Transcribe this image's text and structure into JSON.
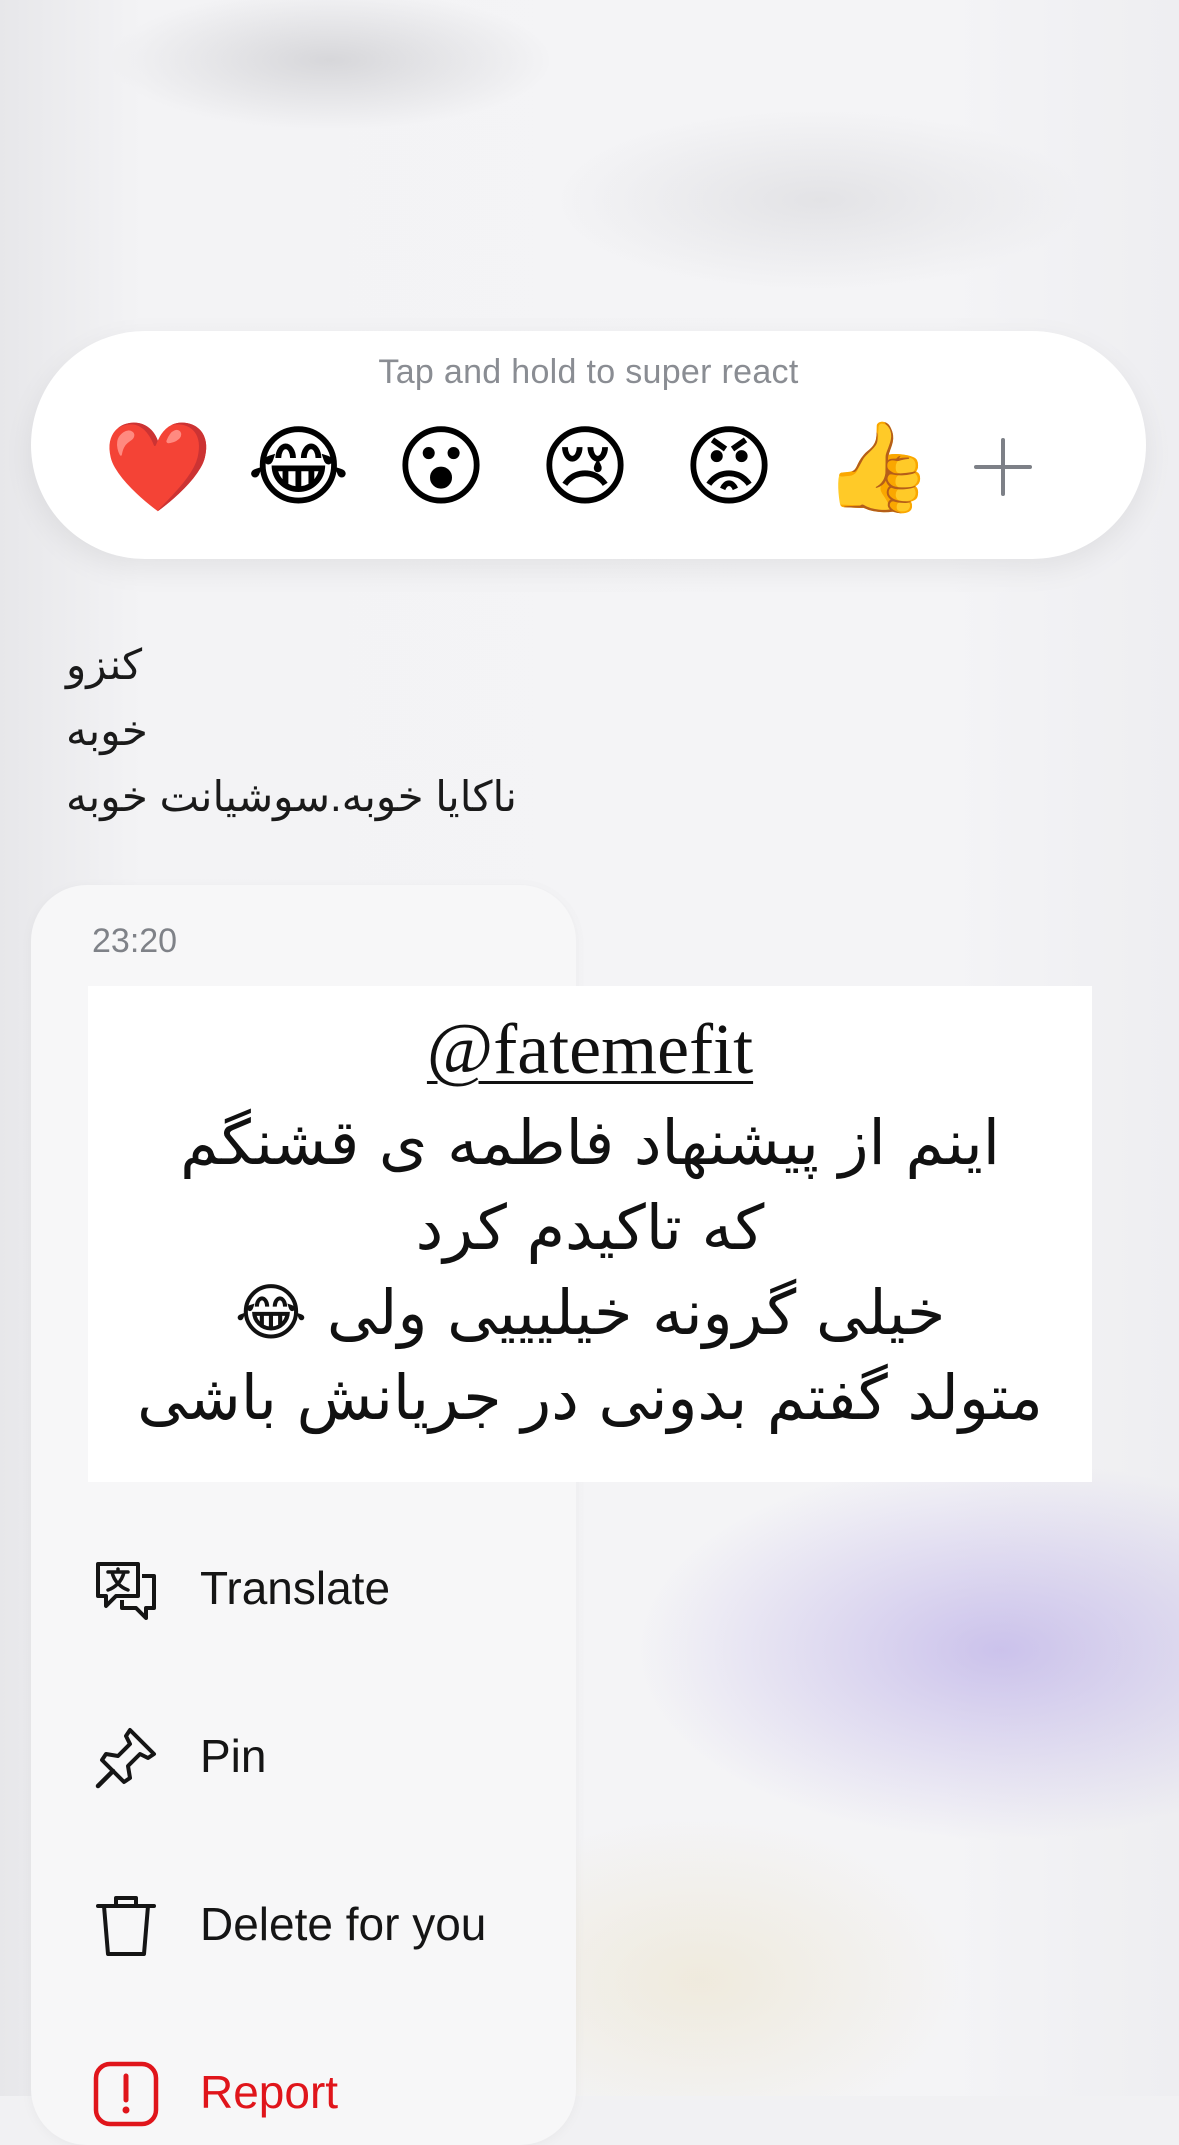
{
  "reaction_bar": {
    "hint": "Tap and hold to super react",
    "emojis": [
      {
        "name": "heart",
        "glyph": "❤️"
      },
      {
        "name": "laugh",
        "glyph": "😂"
      },
      {
        "name": "wow",
        "glyph": "😮"
      },
      {
        "name": "sad",
        "glyph": "😢"
      },
      {
        "name": "angry",
        "glyph": "😡"
      },
      {
        "name": "thumbs-up",
        "glyph": "👍"
      }
    ],
    "more_icon": "plus-icon"
  },
  "previous_message": {
    "lines": [
      "کنزو",
      "خوبه",
      "ناکایا خوبه.سوشیانت خوبه"
    ]
  },
  "selected_message": {
    "timestamp": "23:20",
    "story": {
      "handle": "@fatemefit",
      "lines": [
        "اینم از پیشنهاد فاطمه ی قشنگم",
        "که تاکیدم کرد",
        "خیلی گرونه خیلیییی ولی 😂",
        "متولد گفتم بدونی در جریانش باشی"
      ]
    }
  },
  "menu": {
    "items": [
      {
        "label": "Translate",
        "icon": "translate-icon"
      },
      {
        "label": "Pin",
        "icon": "pin-icon"
      },
      {
        "label": "Delete for you",
        "icon": "trash-icon"
      },
      {
        "label": "Report",
        "icon": "report-icon"
      }
    ]
  },
  "colors": {
    "danger": "#e0151b",
    "panel": "#f7f7f8",
    "hint_text": "#8a8d93"
  }
}
